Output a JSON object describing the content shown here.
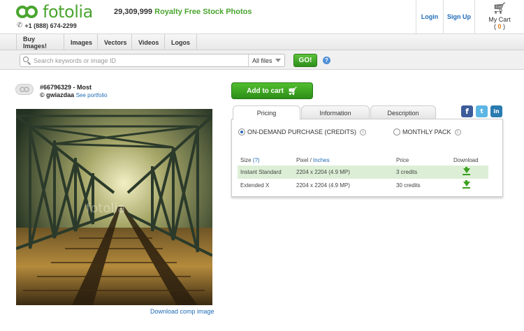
{
  "header": {
    "logo_text": "fotolia",
    "phone": "+1 (888) 674-2299",
    "stock_count": "29,309,999",
    "tagline": "Royalty Free Stock Photos",
    "login": "Login",
    "signup": "Sign Up",
    "cart_label": "My Cart",
    "cart_count": "0"
  },
  "nav": {
    "items": [
      "Buy Images!",
      "Images",
      "Vectors",
      "Videos",
      "Logos"
    ]
  },
  "search": {
    "placeholder": "Search keywords or image ID",
    "filter": "All files",
    "go": "GO!",
    "help": "?"
  },
  "image": {
    "id_title": "#66796329 - Most",
    "author_prefix": "©",
    "author": "gwiazdaa",
    "portfolio": "See portfolio",
    "watermark": "fotolia",
    "download_comp": "Download comp image"
  },
  "actions": {
    "add_to_cart": "Add to cart"
  },
  "tabs": [
    "Pricing",
    "Information",
    "Description"
  ],
  "social": {
    "facebook": "f",
    "twitter": "t",
    "linkedin": "in"
  },
  "pricing": {
    "option_credits": "ON-DEMAND PURCHASE (CREDITS)",
    "option_monthly": "MONTHLY PACK",
    "selected": "credits",
    "headers": {
      "size": "Size",
      "size_help": "(?)",
      "pixel": "Pixel",
      "sep": " / ",
      "inches": "Inches",
      "price": "Price",
      "download": "Download"
    },
    "rows": [
      {
        "size": "Instant Standard",
        "pixel": "2204 x 2204 (4.9 MP)",
        "price": "3 credits"
      },
      {
        "size": "Extended X",
        "pixel": "2204 x 2204 (4.9 MP)",
        "price": "30 credits"
      }
    ]
  },
  "colors": {
    "brand_green": "#4aa52f",
    "link_blue": "#1f6bb6",
    "highlight_row": "#dcefd6"
  }
}
